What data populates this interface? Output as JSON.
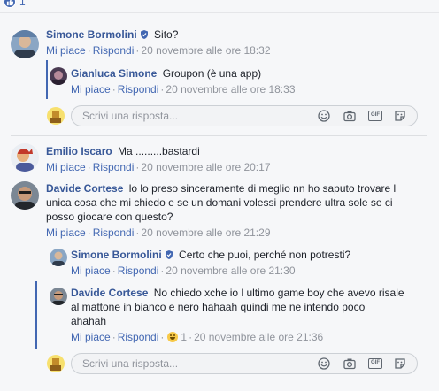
{
  "top": {
    "like_count": "1"
  },
  "reply_placeholder": "Scrivi una risposta...",
  "actions": {
    "like": "Mi piace",
    "reply": "Rispondi",
    "sep": "·"
  },
  "comments": [
    {
      "author": "Simone Bormolini",
      "text": "Sito?",
      "time": "20 novembre alle ore 18:32",
      "replies": [
        {
          "author": "Gianluca Simone",
          "text": "Groupon (è una app)",
          "time": "20 novembre alle ore 18:33"
        }
      ]
    },
    {
      "author": "Emilio Iscaro",
      "text": "Ma .........bastardi",
      "time": "20 novembre alle ore 20:17"
    },
    {
      "author": "Davide Cortese",
      "text_lines": [
        "lo lo preso sinceramente di meglio nn ho saputo trovare l",
        "unica cosa che mi chiedo e se un domani volessi prendere ultra sole se ci",
        "posso giocare con questo?"
      ],
      "time": "20 novembre alle ore 21:29",
      "replies": [
        {
          "author": "Simone Bormolini",
          "text": "Certo che puoi, perché non potresti?",
          "time": "20 novembre alle ore 21:30"
        },
        {
          "author": "Davide Cortese",
          "text_lines": [
            "No chiedo xche io l ultimo game boy che avevo risale",
            "al mattone in bianco e nero hahaah quindi me ne intendo poco",
            "ahahah"
          ],
          "reaction_count": "1",
          "time": "20 novembre alle ore 21:36"
        }
      ]
    }
  ],
  "icons": {
    "like": "thumbs-up-icon",
    "verified": "shield-check-icon",
    "emoji": "smiley-icon",
    "camera": "camera-icon",
    "gif": "gif-icon",
    "sticker": "sticker-icon",
    "reaction": "haha-reaction-icon"
  },
  "colors": {
    "link": "#385898",
    "action": "#4267b2",
    "meta": "#90949c",
    "thread": "#4267b2"
  }
}
